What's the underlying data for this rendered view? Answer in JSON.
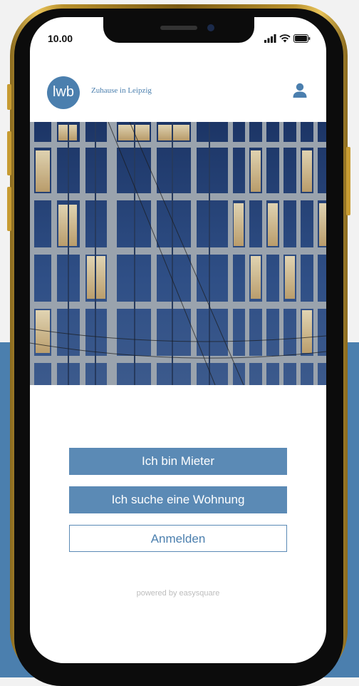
{
  "status_bar": {
    "time": "10.00"
  },
  "header": {
    "logo_text": "lwb",
    "tagline": "Zuhause in Leipzig"
  },
  "actions": {
    "tenant_label": "Ich bin Mieter",
    "search_label": "Ich suche eine Wohnung",
    "login_label": "Anmelden"
  },
  "footer": {
    "powered": "powered by easysquare"
  },
  "icons": {
    "user": "user-icon",
    "signal": "signal-icon",
    "wifi": "wifi-icon",
    "battery": "battery-icon"
  },
  "colors": {
    "brand": "#4b7fae",
    "button": "#5b8ab5",
    "background_accent": "#4b7fae"
  }
}
